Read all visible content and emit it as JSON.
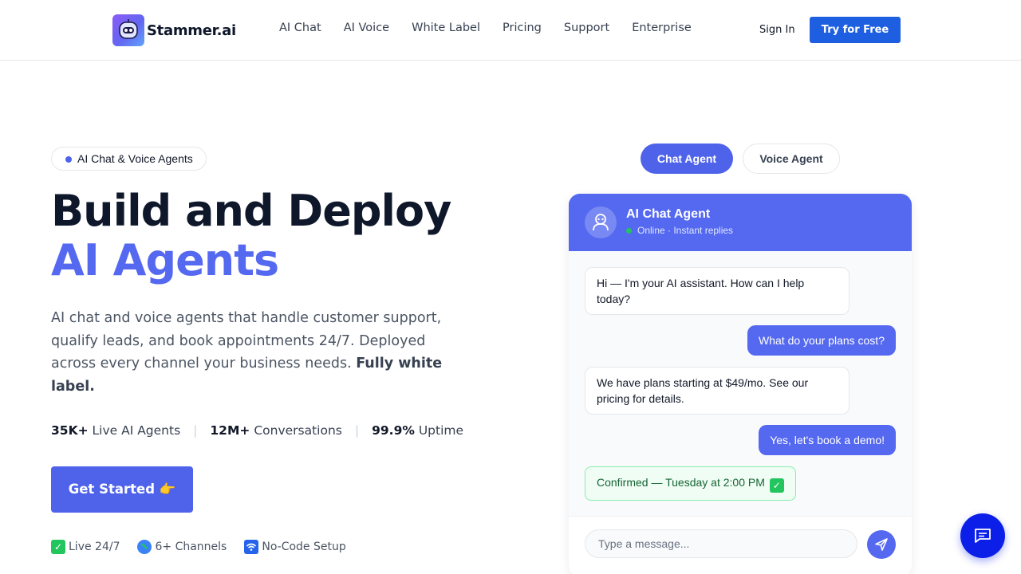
{
  "brand": {
    "name": "Stammer.ai",
    "logo_icon": "robot-face-icon"
  },
  "nav": {
    "items": [
      {
        "label": "AI Chat"
      },
      {
        "label": "AI Voice"
      },
      {
        "label": "White Label"
      },
      {
        "label": "Pricing"
      },
      {
        "label": "Support"
      },
      {
        "label": "Enterprise"
      }
    ],
    "sign_in": "Sign In",
    "try_free": "Try for Free"
  },
  "hero": {
    "badge": "AI Chat & Voice Agents",
    "title_line1": "Build and Deploy",
    "title_line2": "AI Agents",
    "lead": "AI chat and voice agents that handle customer support, qualify leads, and book appointments 24/7. Deployed across every channel your business needs.",
    "lead_bold": "Fully white label.",
    "stats": [
      {
        "value": "35K+",
        "label": "Live AI Agents"
      },
      {
        "value": "12M+",
        "label": "Conversations"
      },
      {
        "value": "99.9%",
        "label": "Uptime"
      }
    ],
    "stat_separator": "|",
    "cta": "Get Started 👉",
    "features": [
      {
        "icon": "check-icon",
        "label": "Live 24/7"
      },
      {
        "icon": "globe-icon",
        "label": "6+ Channels"
      },
      {
        "icon": "wifi-icon",
        "label": "No-Code Setup"
      }
    ]
  },
  "demo": {
    "tabs": [
      {
        "label": "Chat Agent",
        "active": true
      },
      {
        "label": "Voice Agent",
        "active": false
      }
    ],
    "chat": {
      "title": "AI Chat Agent",
      "status": "Online · Instant replies",
      "messages": [
        {
          "from": "bot",
          "text": "Hi — I'm your AI assistant. How can I help today?"
        },
        {
          "from": "user",
          "text": "What do your plans cost?"
        },
        {
          "from": "bot",
          "text": "We have plans starting at $49/mo. See our pricing for details."
        },
        {
          "from": "user",
          "text": "Yes, let's book a demo!"
        },
        {
          "from": "bot-confirm",
          "text": "Confirmed — Tuesday at 2:00 PM"
        }
      ],
      "input_placeholder": "Type a message..."
    }
  },
  "colors": {
    "accent": "#5468f0",
    "primary_button": "#1d5fe0",
    "fab": "#0b1fe8",
    "online": "#22c55e"
  }
}
